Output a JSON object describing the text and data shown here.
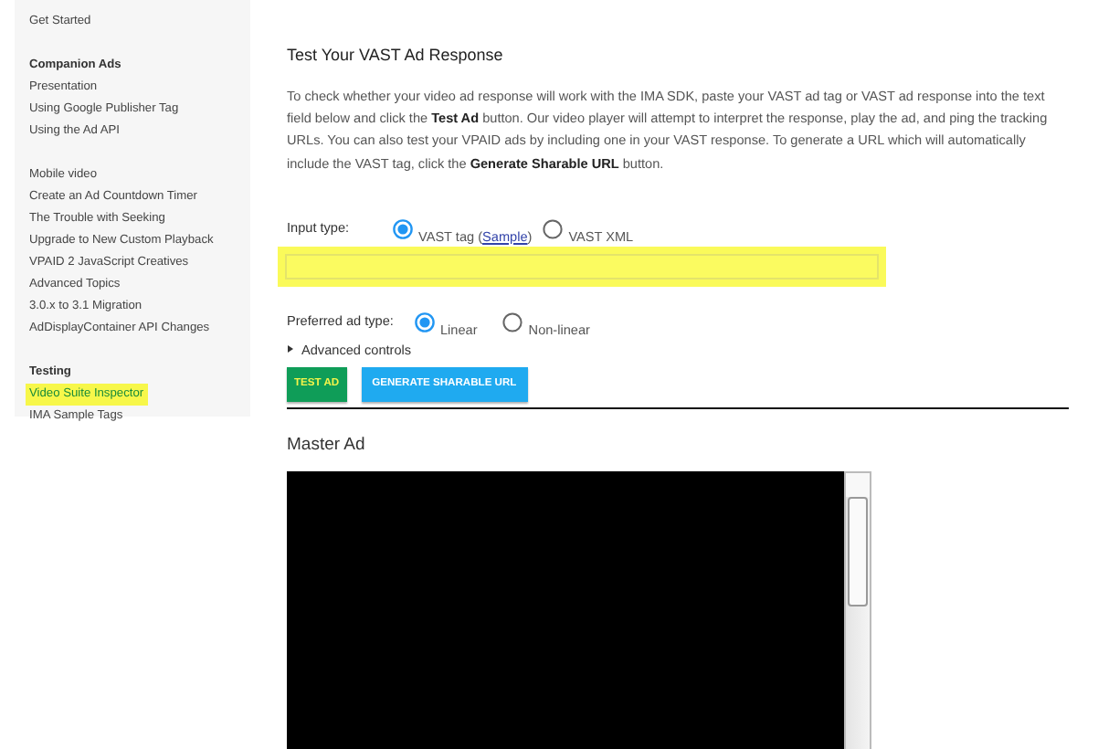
{
  "sidebar": {
    "groups": [
      {
        "items": [
          {
            "label": "Get Started",
            "selected": false
          }
        ]
      },
      {
        "heading": "Companion Ads",
        "items": [
          {
            "label": "Presentation",
            "selected": false
          },
          {
            "label": "Using Google Publisher Tag",
            "selected": false
          },
          {
            "label": "Using the Ad API",
            "selected": false
          }
        ]
      },
      {
        "items": [
          {
            "label": "Mobile video",
            "selected": false
          },
          {
            "label": "Create an Ad Countdown Timer",
            "selected": false
          },
          {
            "label": "The Trouble with Seeking",
            "selected": false
          },
          {
            "label": "Upgrade to New Custom Playback",
            "selected": false
          },
          {
            "label": "VPAID 2 JavaScript Creatives",
            "selected": false
          },
          {
            "label": "Advanced Topics",
            "selected": false
          },
          {
            "label": "3.0.x to 3.1 Migration",
            "selected": false
          },
          {
            "label": "AdDisplayContainer API Changes",
            "selected": false
          }
        ]
      },
      {
        "heading": "Testing",
        "items": [
          {
            "label": "Video Suite Inspector",
            "selected": true
          },
          {
            "label": "IMA Sample Tags",
            "selected": false
          }
        ]
      }
    ]
  },
  "section": {
    "heading": "Test Your VAST Ad Response",
    "intro": "To check whether your video ad response will work with the IMA SDK, paste your VAST ad tag or VAST ad response into the text field below and click the **Test Ad** button. Our video player will attempt to interpret the response, play the ad, and ping the tracking URLs. You can also test your VPAID ads by including one in your VAST response. To generate a URL which will automatically include the VAST tag, click the **Generate Sharable URL** button.",
    "input_type": {
      "label": "Input type:",
      "options": [
        {
          "label": "VAST tag (",
          "link": "Sample",
          "after": ")",
          "selected": true
        },
        {
          "label": "VAST XML",
          "selected": false
        }
      ]
    },
    "ad_tag_field": {
      "highlighted": true
    },
    "preferred_ad_type": {
      "label": "Preferred ad type:",
      "options": [
        {
          "label": "Linear",
          "selected": true
        },
        {
          "label": "Non-linear",
          "selected": false
        }
      ]
    },
    "advanced_controls": {
      "label": "Advanced controls",
      "expanded": false
    },
    "buttons": [
      {
        "label": "TEST AD",
        "kind": "primary"
      },
      {
        "label": "GENERATE SHARABLE URL",
        "kind": "secondary"
      }
    ]
  },
  "master_ad": {
    "heading": "Master Ad"
  }
}
